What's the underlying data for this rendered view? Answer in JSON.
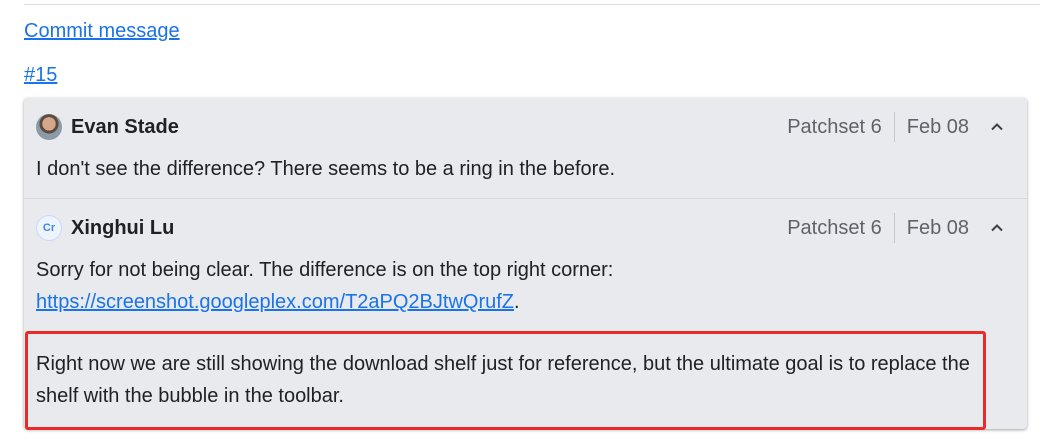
{
  "links": {
    "commit_message": "Commit message",
    "issue": "#15"
  },
  "comments": [
    {
      "author": "Evan Stade",
      "avatar_icon": "user-photo-icon",
      "patchset": "Patchset 6",
      "date": "Feb 08",
      "body": "I don't see the difference? There seems to be a ring in the before."
    },
    {
      "author": "Xinghui Lu",
      "avatar_icon": "cr-avatar-icon",
      "avatar_text": "Cr",
      "patchset": "Patchset 6",
      "date": "Feb 08",
      "body_line1": "Sorry for not being clear. The difference is on the top right corner:",
      "body_link": "https://screenshot.googleplex.com/T2aPQ2BJtwQrufZ",
      "body_link_suffix": ".",
      "body_p2": "Right now we are still showing the download shelf just for reference, but the ultimate goal is to replace the shelf with the bubble in the toolbar."
    }
  ],
  "colors": {
    "link": "#1a73e8",
    "highlight_box": "#ea2b2b",
    "thread_bg": "#e8eaed"
  }
}
